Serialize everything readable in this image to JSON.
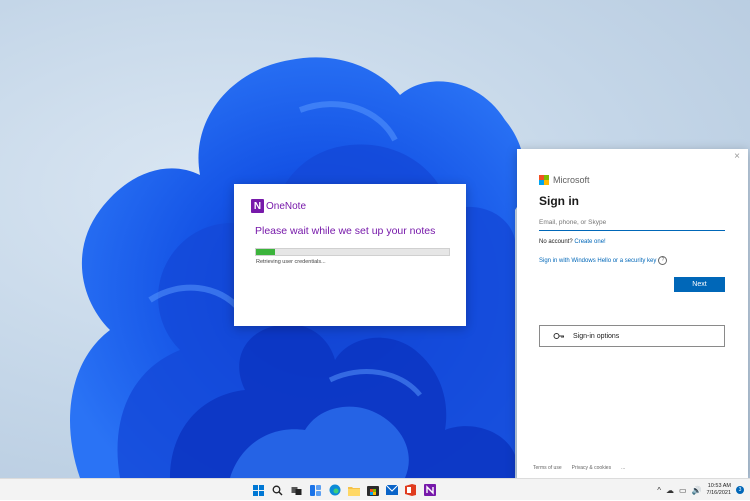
{
  "onenote": {
    "app_name": "OneNote",
    "logo_letter": "N",
    "message": "Please wait while we set up your notes",
    "status": "Retrieving user credentials...",
    "progress_percent": 10,
    "accent": "#7719aa",
    "progress_color": "#3cb43c"
  },
  "signin": {
    "close_glyph": "×",
    "brand": "Microsoft",
    "title": "Sign in",
    "input_placeholder": "Email, phone, or Skype",
    "no_account": "No account?",
    "create_link": "Create one!",
    "hello_link": "Sign in with Windows Hello or a security key",
    "help_glyph": "?",
    "next_label": "Next",
    "options_label": "Sign-in options",
    "footer": [
      "Terms of use",
      "Privacy & cookies",
      "..."
    ],
    "accent": "#0067b8"
  },
  "taskbar": {
    "icons": [
      "windows-start-icon",
      "search-icon",
      "task-view-icon",
      "widgets-icon",
      "edge-icon",
      "file-explorer-icon",
      "store-icon",
      "mail-icon",
      "office-icon",
      "onenote-icon"
    ],
    "tray_symbols": [
      "^",
      "☁",
      "▭",
      "🔊"
    ],
    "time": "10:53 AM",
    "date": "7/16/2021",
    "notification_count": "3"
  }
}
